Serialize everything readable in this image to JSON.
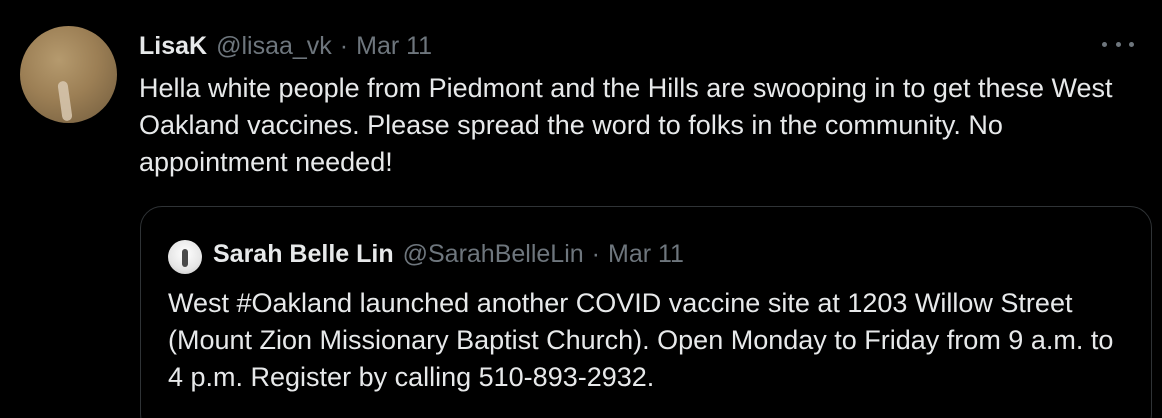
{
  "tweet": {
    "author_name": "LisaK",
    "author_handle": "@lisaa_vk",
    "separator": "·",
    "date": "Mar 11",
    "text": "Hella white people from Piedmont and the Hills are swooping in to get these West Oakland vaccines. Please spread the word to folks in the community. No appointment needed!",
    "more_icon": "more-horizontal-icon"
  },
  "quoted_tweet": {
    "author_name": "Sarah Belle Lin",
    "author_handle": "@SarahBelleLin",
    "separator": "·",
    "date": "Mar 11",
    "text": "West #Oakland launched another COVID vaccine site at 1203 Willow Street (Mount Zion Missionary Baptist Church). Open Monday to Friday from 9 a.m. to 4 p.m. Register by calling 510-893-2932."
  },
  "colors": {
    "background": "#000000",
    "primary_text": "#e7e9ea",
    "secondary_text": "#6e767d",
    "border": "#2f3336"
  }
}
